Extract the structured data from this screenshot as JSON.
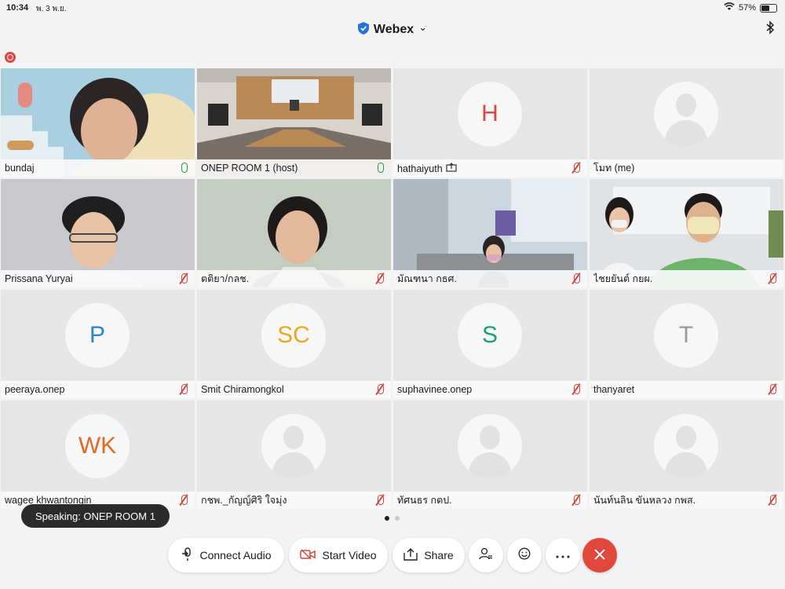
{
  "status_bar": {
    "time": "10:34",
    "date": "พ. 3 พ.ย.",
    "battery": "57%",
    "battery_level": 0.57
  },
  "header": {
    "title": "Webex",
    "title_chevron": "⌄"
  },
  "participants": [
    {
      "name": "bundaj",
      "mic": "on",
      "video": true
    },
    {
      "name": "ONEP ROOM 1 (host)",
      "mic": "on",
      "video": true
    },
    {
      "name": "hathaiyuth",
      "initials": "H",
      "mic": "off",
      "video": false,
      "initials_color": "#d9473c",
      "sharing": true
    },
    {
      "name": "โมท (me)",
      "mic": "none",
      "video": false
    },
    {
      "name": "Prissana Yuryai",
      "mic": "off",
      "video": true
    },
    {
      "name": "ตติยา/กลช.",
      "mic": "off",
      "video": true
    },
    {
      "name": "มัณฑนา กธศ.",
      "mic": "off",
      "video": true
    },
    {
      "name": "ไชยยันต์ กยผ.",
      "mic": "off",
      "video": true
    },
    {
      "name": "peeraya.onep",
      "initials": "P",
      "mic": "off",
      "video": false,
      "initials_color": "#2a86c4"
    },
    {
      "name": "Smit Chiramongkol",
      "initials": "SC",
      "mic": "off",
      "video": false,
      "initials_color": "#e6a91f"
    },
    {
      "name": "suphavinee.onep",
      "initials": "S",
      "mic": "off",
      "video": false,
      "initials_color": "#18a06e"
    },
    {
      "name": "thanyaret",
      "initials": "T",
      "mic": "off",
      "video": false,
      "initials_color": "#9a9a9a"
    },
    {
      "name": "wagee khwantongin",
      "initials": "WK",
      "mic": "off",
      "video": false,
      "initials_color": "#e06a24"
    },
    {
      "name": "กชพ._กัญญ์ศิริ ใจมุ่ง",
      "mic": "off",
      "video": false
    },
    {
      "name": "ทัศนธร กตป.",
      "mic": "off",
      "video": false
    },
    {
      "name": "นันท์นลิน ขันหลวง กพส.",
      "mic": "off",
      "video": false
    }
  ],
  "speaking": "Speaking: ONEP ROOM 1",
  "controls": {
    "connect_audio": "Connect Audio",
    "start_video": "Start Video",
    "share": "Share"
  },
  "colors": {
    "accent": "#2c8a9e",
    "end_call": "#e0483d",
    "mic_on": "#1aa34a",
    "mic_off": "#d7463c"
  }
}
